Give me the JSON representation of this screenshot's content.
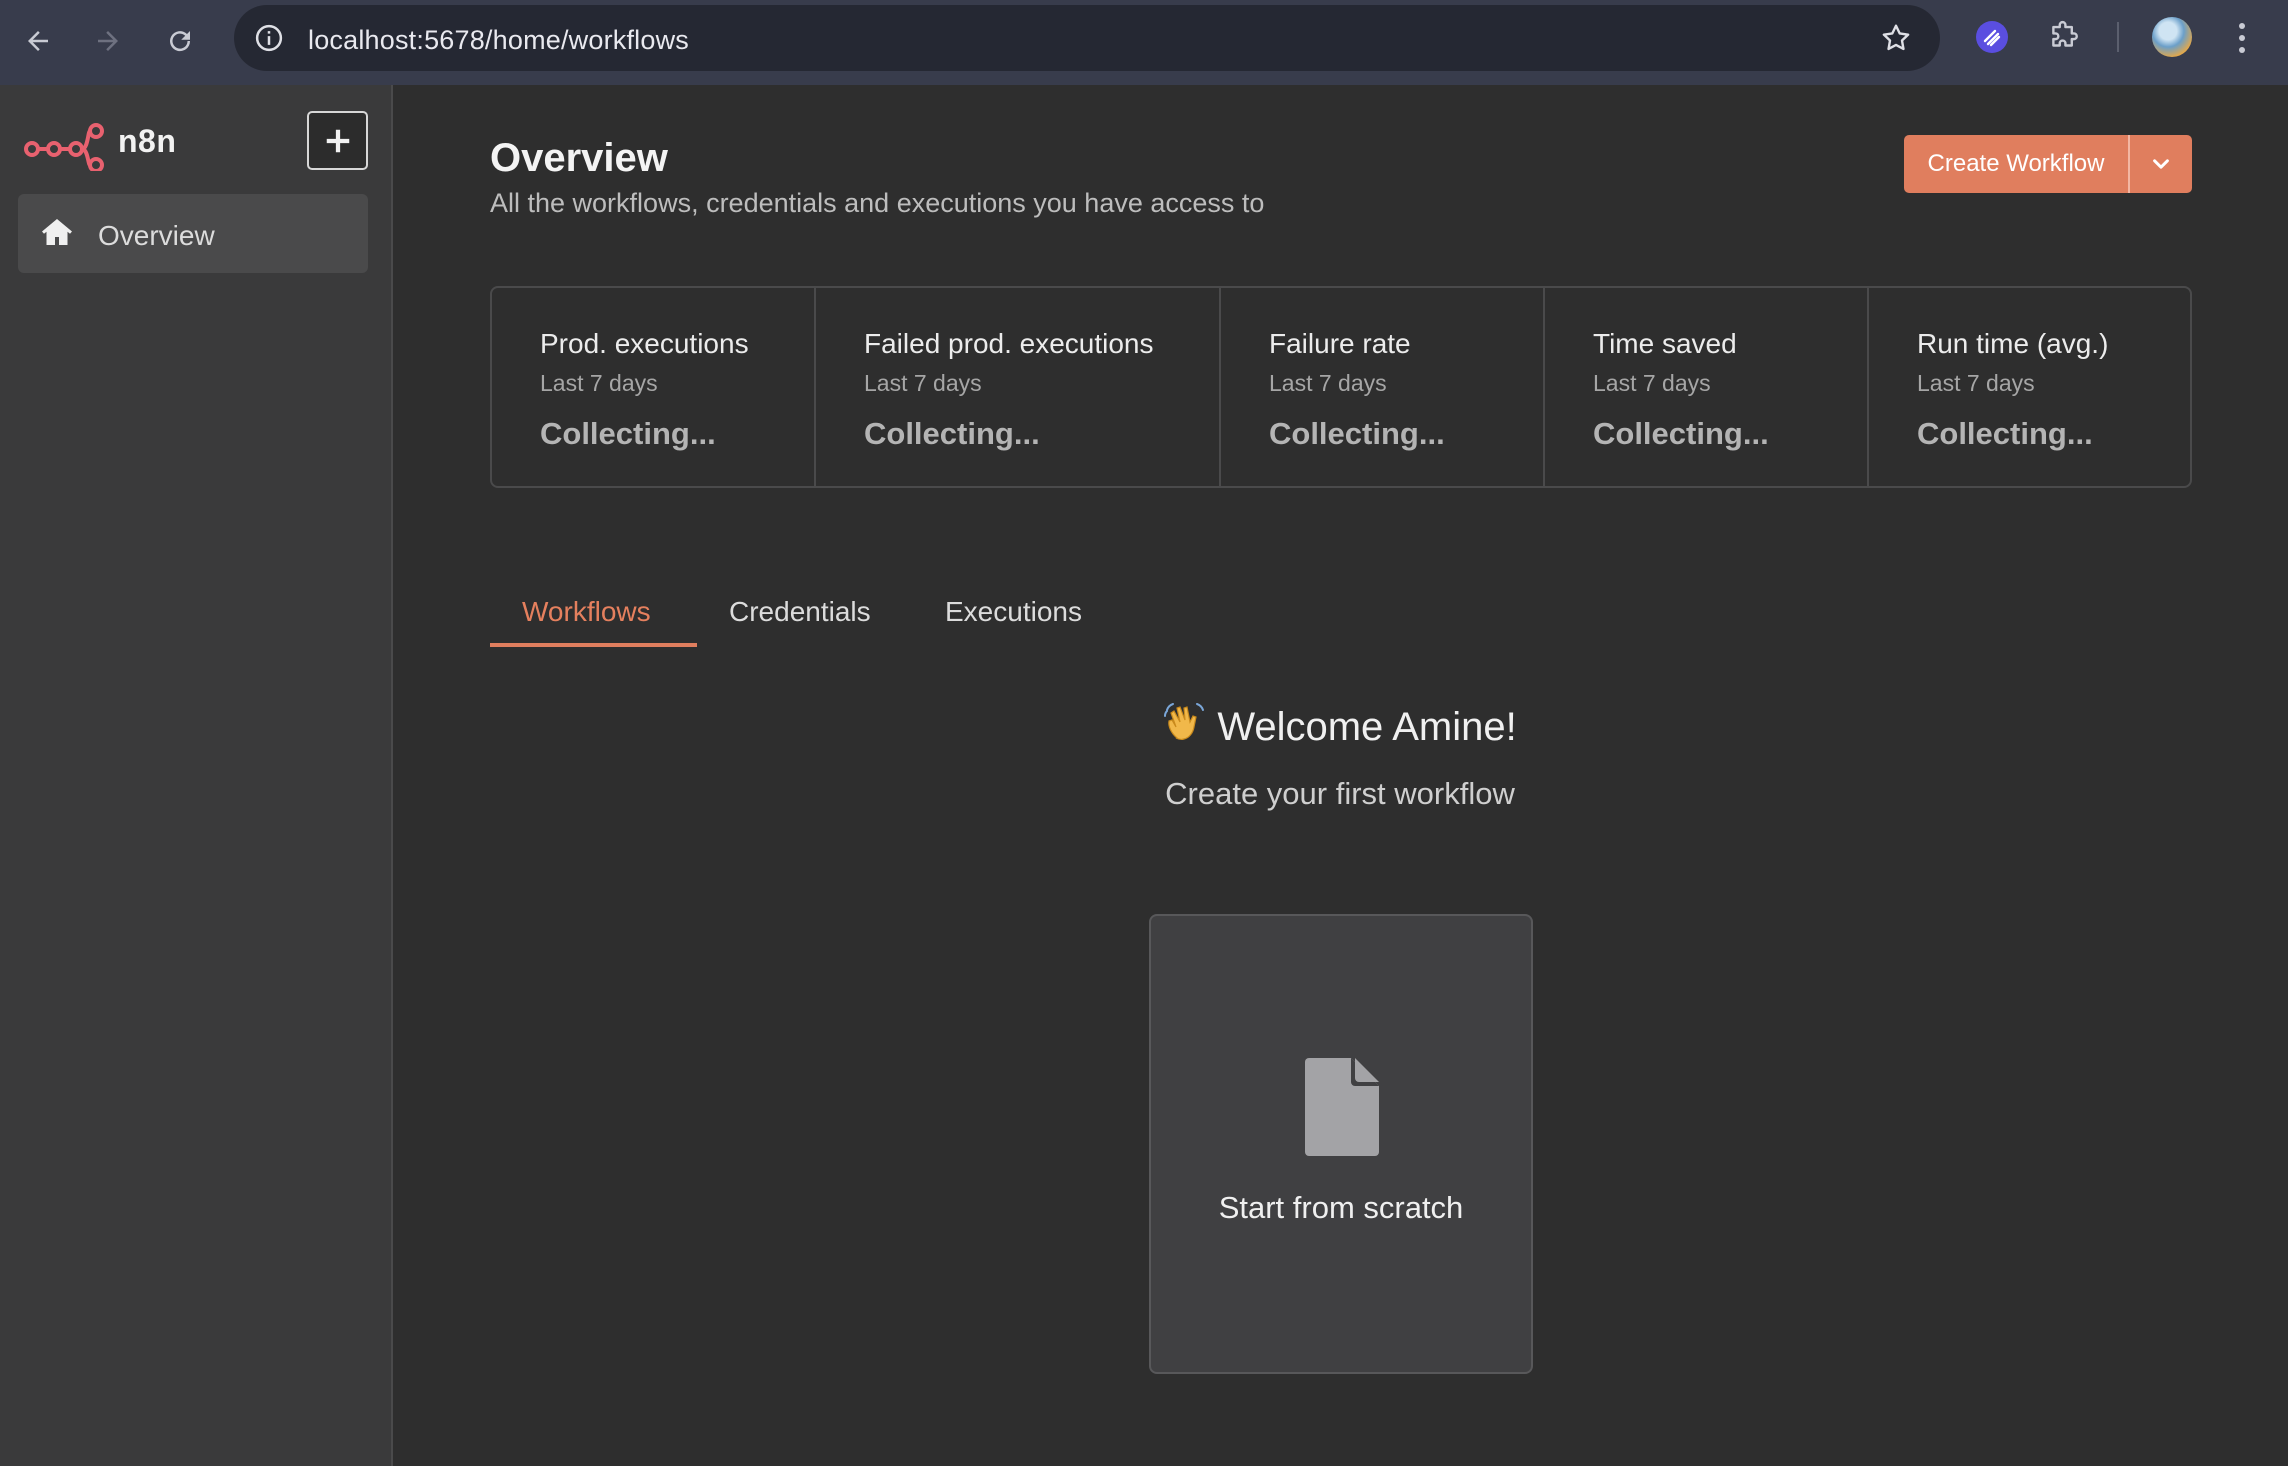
{
  "browser": {
    "url": "localhost:5678/home/workflows",
    "icons": [
      "back-arrow-icon",
      "forward-arrow-icon",
      "reload-icon",
      "info-icon",
      "star-icon",
      "extension-icon",
      "puzzle-icon",
      "avatar",
      "kebab-menu-icon"
    ]
  },
  "sidebar": {
    "brand": "n8n",
    "items": [
      {
        "label": "Overview",
        "icon": "home-icon"
      }
    ]
  },
  "header": {
    "title": "Overview",
    "subtitle": "All the workflows, credentials and executions you have access to",
    "create_label": "Create Workflow"
  },
  "stats": [
    {
      "title": "Prod. executions",
      "period": "Last 7 days",
      "value": "Collecting..."
    },
    {
      "title": "Failed prod. executions",
      "period": "Last 7 days",
      "value": "Collecting..."
    },
    {
      "title": "Failure rate",
      "period": "Last 7 days",
      "value": "Collecting..."
    },
    {
      "title": "Time saved",
      "period": "Last 7 days",
      "value": "Collecting..."
    },
    {
      "title": "Run time (avg.)",
      "period": "Last 7 days",
      "value": "Collecting..."
    }
  ],
  "tabs": [
    {
      "label": "Workflows",
      "active": true
    },
    {
      "label": "Credentials",
      "active": false
    },
    {
      "label": "Executions",
      "active": false
    }
  ],
  "empty_state": {
    "welcome": "Welcome Amine!",
    "subtitle": "Create your first workflow",
    "card_label": "Start from scratch"
  },
  "colors": {
    "accent": "#e07e5e",
    "background": "#2e2e2e",
    "sidebar": "#3a3a3b",
    "chrome": "#383c4c"
  }
}
